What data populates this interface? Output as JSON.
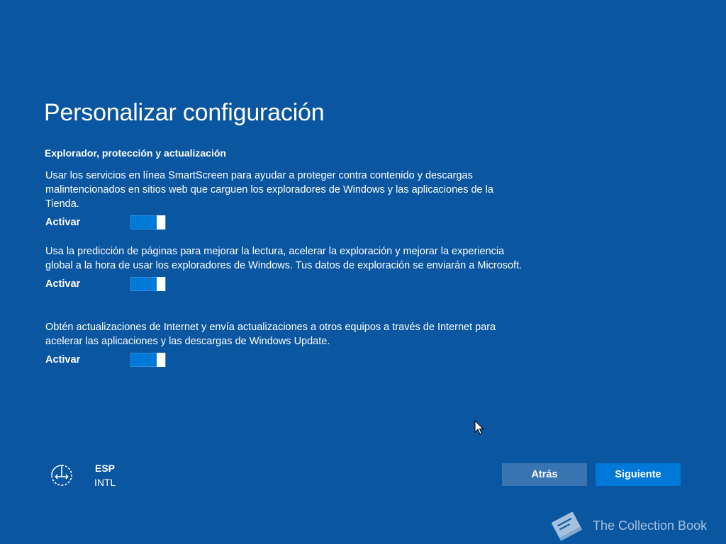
{
  "page": {
    "title": "Personalizar configuración",
    "section_heading": "Explorador, protección y actualización"
  },
  "settings": [
    {
      "description": "Usar los servicios en línea SmartScreen para ayudar a proteger contra contenido y descargas malintencionados en sitios web que carguen los exploradores de Windows y las aplicaciones de la Tienda.",
      "toggle_label": "Activar",
      "state": "on"
    },
    {
      "description": "Usa la predicción de páginas para mejorar la lectura, acelerar la exploración y mejorar la experiencia global a la hora de usar los exploradores de Windows. Tus datos de exploración se enviarán a Microsoft.",
      "toggle_label": "Activar",
      "state": "on"
    },
    {
      "description": "Obtén actualizaciones de Internet y envía actualizaciones a otros equipos a través de Internet para acelerar las aplicaciones y las descargas de Windows Update.",
      "toggle_label": "Activar",
      "state": "on"
    }
  ],
  "language": {
    "code": "ESP",
    "layout": "INTL",
    "icon": "accessibility-icon"
  },
  "buttons": {
    "back_label": "Atrás",
    "next_label": "Siguiente"
  },
  "watermark": {
    "text": "The Collection Book",
    "icon": "book-icon"
  },
  "colors": {
    "background": "#0a56a0",
    "accent": "#0078d7",
    "secondary_button": "#3a75b3"
  }
}
